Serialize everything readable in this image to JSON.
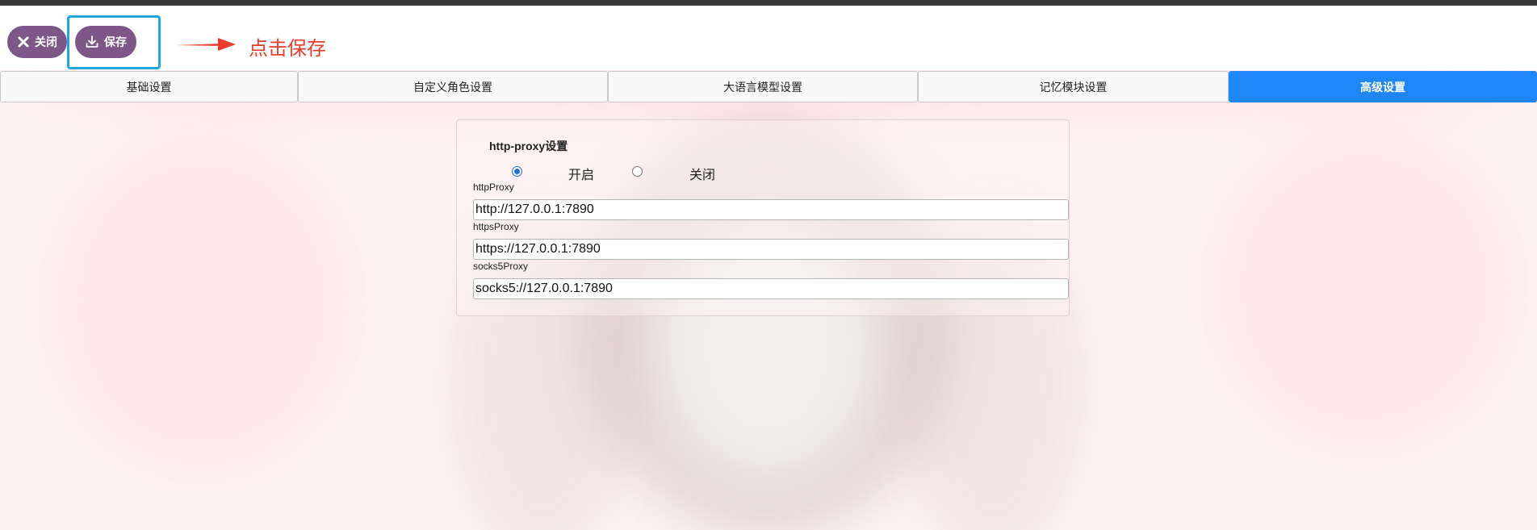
{
  "toolbar": {
    "close_label": "关闭",
    "save_label": "保存",
    "annotation": "点击保存",
    "accent": "#7d5788",
    "highlight_color": "#20a6e0",
    "annotation_color": "#ec3b2d"
  },
  "tabs": [
    {
      "label": "基础设置",
      "active": false
    },
    {
      "label": "自定义角色设置",
      "active": false
    },
    {
      "label": "大语言模型设置",
      "active": false
    },
    {
      "label": "记忆模块设置",
      "active": false
    },
    {
      "label": "高级设置",
      "active": true
    }
  ],
  "active_tab_color": "#1e86f5",
  "proxy": {
    "title": "http-proxy设置",
    "options": [
      {
        "label": "开启",
        "checked": true
      },
      {
        "label": "关闭",
        "checked": false
      }
    ],
    "fields": [
      {
        "label": "httpProxy",
        "value": "http://127.0.0.1:7890"
      },
      {
        "label": "httpsProxy",
        "value": "https://127.0.0.1:7890"
      },
      {
        "label": "socks5Proxy",
        "value": "socks5://127.0.0.1:7890"
      }
    ]
  }
}
